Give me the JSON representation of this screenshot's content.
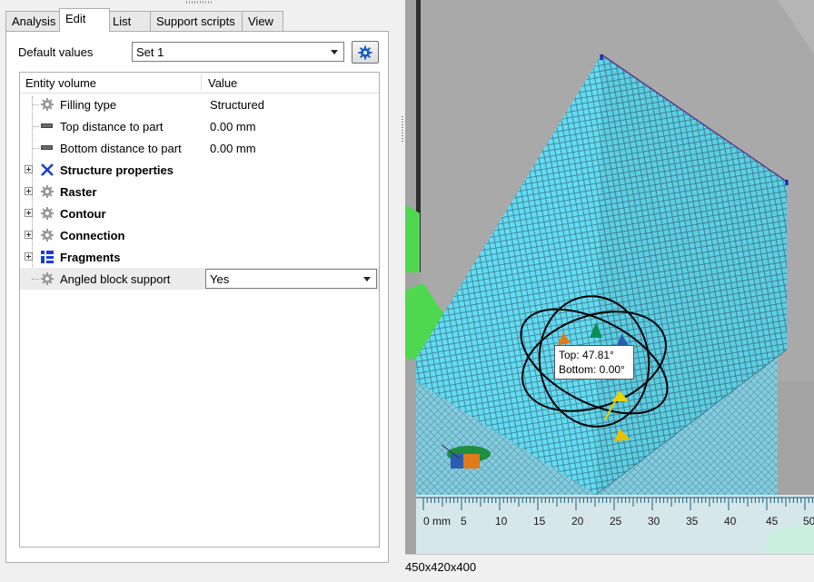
{
  "tabs": [
    "Analysis",
    "Edit",
    "List",
    "Support scripts",
    "View"
  ],
  "active_tab": "Edit",
  "default_values": {
    "label": "Default values",
    "value": "Set 1"
  },
  "grid": {
    "headers": [
      "Entity volume",
      "Value"
    ],
    "rows": [
      {
        "label": "Filling type",
        "value": "Structured",
        "icon": "gear-icon"
      },
      {
        "label": "Top distance to part",
        "value": "0.00 mm",
        "icon": "bar-icon"
      },
      {
        "label": "Bottom distance to part",
        "value": "0.00 mm",
        "icon": "bar-icon"
      },
      {
        "label": "Structure properties",
        "value": "",
        "icon": "x-icon",
        "bold": true,
        "expandable": true
      },
      {
        "label": "Raster",
        "value": "",
        "icon": "gear-icon",
        "bold": true,
        "expandable": true
      },
      {
        "label": "Contour",
        "value": "",
        "icon": "gear-icon",
        "bold": true,
        "expandable": true
      },
      {
        "label": "Connection",
        "value": "",
        "icon": "gear-icon",
        "bold": true,
        "expandable": true
      },
      {
        "label": "Fragments",
        "value": "",
        "icon": "fragments-icon",
        "bold": true,
        "expandable": true
      },
      {
        "label": "Angled block support",
        "value": "Yes",
        "icon": "gear-icon",
        "selected": true,
        "dropdown": true
      }
    ]
  },
  "viewport": {
    "tooltip": {
      "top": "Top: 47.81°",
      "bottom": "Bottom: 0.00°"
    },
    "ruler": {
      "unit": "0 mm",
      "ticks": [
        "5",
        "10",
        "15",
        "20",
        "25",
        "30",
        "35",
        "40",
        "45",
        "50"
      ]
    },
    "colors": {
      "background": "#a3a3a3",
      "support": "#5fd8f0",
      "part_green": "#4fd84f",
      "ruler": "#dff3f8"
    }
  },
  "status_bar": {
    "dimensions": "450x420x400"
  }
}
